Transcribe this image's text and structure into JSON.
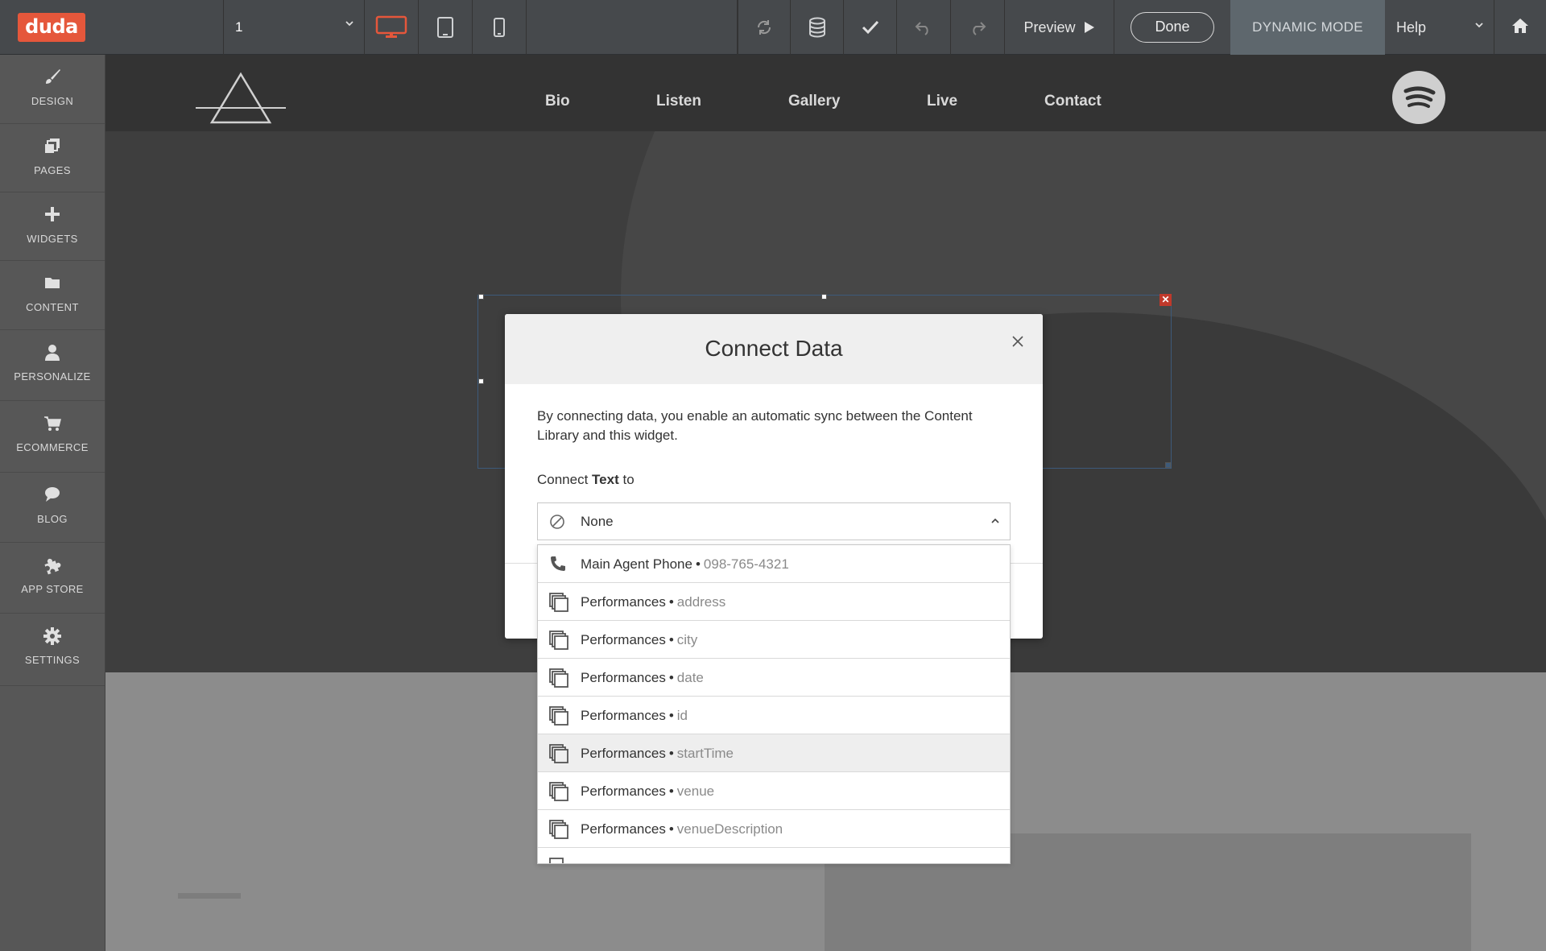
{
  "topbar": {
    "logo": "duda",
    "page_select": "1",
    "preview_label": "Preview",
    "done_label": "Done",
    "dynamic_mode_label": "DYNAMIC MODE",
    "help_label": "Help",
    "accent": "#e5573b"
  },
  "sidebar": {
    "items": [
      {
        "label": "DESIGN",
        "icon": "brush-icon"
      },
      {
        "label": "PAGES",
        "icon": "pages-icon"
      },
      {
        "label": "WIDGETS",
        "icon": "plus-icon"
      },
      {
        "label": "CONTENT",
        "icon": "folder-icon"
      },
      {
        "label": "PERSONALIZE",
        "icon": "user-icon"
      },
      {
        "label": "ECOMMERCE",
        "icon": "cart-icon"
      },
      {
        "label": "BLOG",
        "icon": "chat-icon"
      },
      {
        "label": "APP STORE",
        "icon": "puzzle-icon"
      },
      {
        "label": "SETTINGS",
        "icon": "gear-icon"
      }
    ]
  },
  "site": {
    "nav": [
      "Bio",
      "Listen",
      "Gallery",
      "Live",
      "Contact"
    ]
  },
  "modal": {
    "title": "Connect Data",
    "description": "By connecting data, you enable an automatic sync between the Content Library and this widget.",
    "label_prefix": "Connect ",
    "label_bold": "Text",
    "label_suffix": " to",
    "selected": "None",
    "options": [
      {
        "name": "Main Agent Phone",
        "value": "098-765-4321",
        "icon": "phone-icon"
      },
      {
        "name": "Performances",
        "value": "address",
        "icon": "collection-icon"
      },
      {
        "name": "Performances",
        "value": "city",
        "icon": "collection-icon"
      },
      {
        "name": "Performances",
        "value": "date",
        "icon": "collection-icon"
      },
      {
        "name": "Performances",
        "value": "id",
        "icon": "collection-icon"
      },
      {
        "name": "Performances",
        "value": "startTime",
        "icon": "collection-icon",
        "highlighted": true
      },
      {
        "name": "Performances",
        "value": "venue",
        "icon": "collection-icon"
      },
      {
        "name": "Performances",
        "value": "venueDescription",
        "icon": "collection-icon"
      }
    ]
  }
}
